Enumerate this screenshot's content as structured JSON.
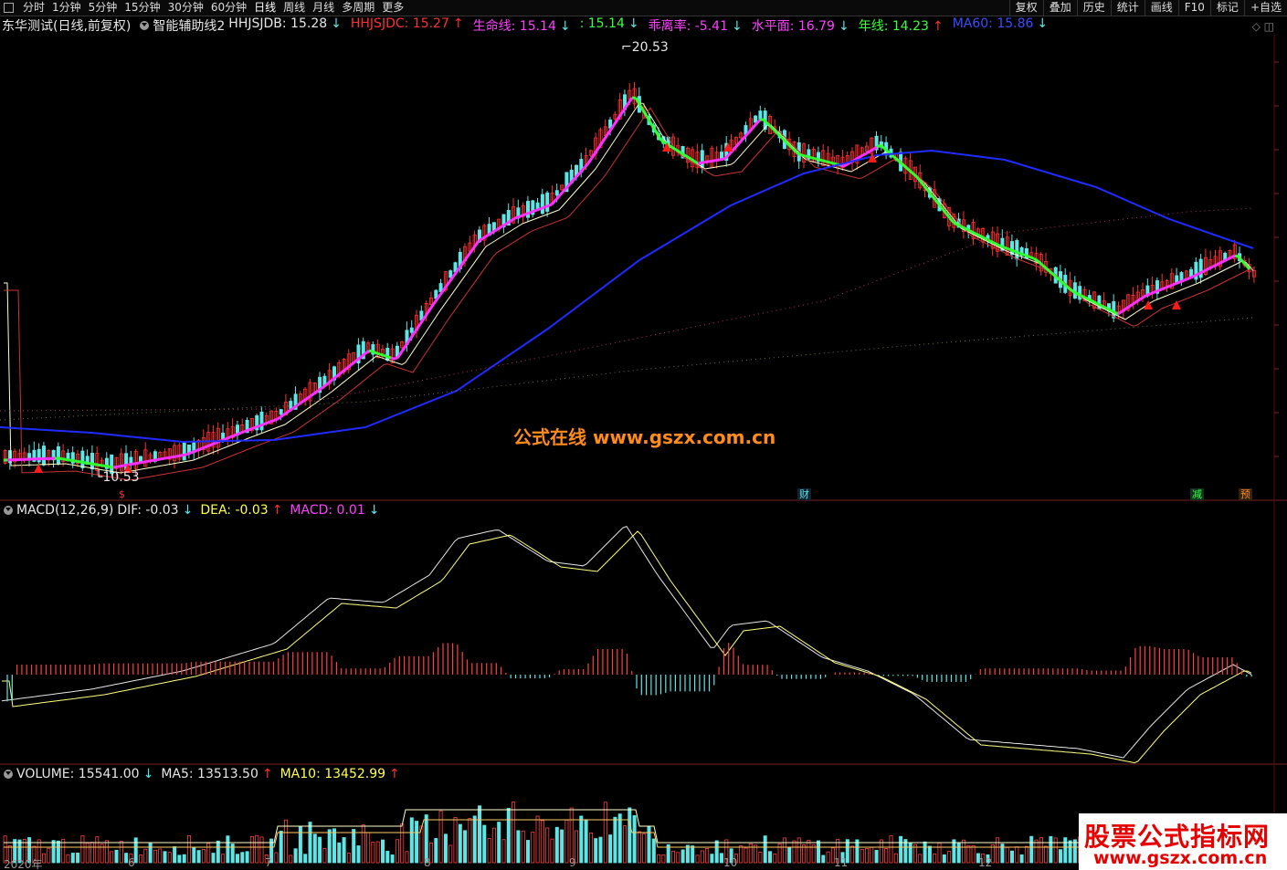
{
  "toolbar": {
    "left": [
      "分时",
      "1分钟",
      "5分钟",
      "15分钟",
      "30分钟",
      "60分钟",
      "日线",
      "周线",
      "月线",
      "多周期",
      "更多"
    ],
    "active": "日线",
    "right": [
      "复权",
      "叠加",
      "历史",
      "统计",
      "画线",
      "F10",
      "标记",
      "+自选"
    ]
  },
  "main": {
    "stock": "东华测试(日线,前复权)",
    "indicator_name": "智能辅助线2",
    "values": [
      {
        "label": "HHJSJDB: 15.28",
        "arrow": "↓",
        "color": "#e6e6e6"
      },
      {
        "label": "HHJSJDC: 15.27",
        "arrow": "↑",
        "color": "#ff3030"
      },
      {
        "label": "生命线: 15.14",
        "arrow": "↓",
        "color": "#ff40ff"
      },
      {
        "label": ": 15.14",
        "arrow": "↓",
        "color": "#3cff3c"
      },
      {
        "label": "乖离率: -5.41",
        "arrow": "↓",
        "color": "#ff40ff"
      },
      {
        "label": "水平面: 16.79",
        "arrow": "↓",
        "color": "#ff40ff"
      },
      {
        "label": "年线: 14.23",
        "arrow": "↑",
        "color": "#3cff3c"
      },
      {
        "label": "MA60: 15.86",
        "arrow": "↓",
        "color": "#3a4dff"
      }
    ],
    "high_label": "20.53",
    "low_label": "10.53",
    "watermark": "公式在线  www.gszx.com.cn",
    "event_tags": [
      {
        "text": "$",
        "color": "#ff3030"
      },
      {
        "text": "财",
        "color": "#5ce6e6"
      },
      {
        "text": "减",
        "color": "#3cff3c"
      },
      {
        "text": "预",
        "color": "#ff8c1a"
      }
    ]
  },
  "macd": {
    "title": "MACD(12,26,9)",
    "dif": "DIF: -0.03",
    "dif_arrow": "↓",
    "dea": "DEA: -0.03",
    "dea_arrow": "↑",
    "macd": "MACD: 0.01",
    "macd_arrow": "↓"
  },
  "volume": {
    "title": "VOLUME: 15541.00",
    "vol_arrow": "↓",
    "ma5": "MA5: 13513.50",
    "ma5_arrow": "↑",
    "ma10": "MA10: 13452.99",
    "ma10_arrow": "↑"
  },
  "x_axis": [
    "2020年",
    "6",
    "7",
    "8",
    "9",
    "10",
    "11",
    "12"
  ],
  "corner_logo": {
    "line1": "股票公式指标网",
    "line2": "www.gszx.com.cn"
  },
  "colors": {
    "up": "#ff3030",
    "down": "#5ce6e6",
    "ma60": "#1f2bff",
    "life_up": "#ff30ff",
    "life_down": "#30ff30"
  }
}
